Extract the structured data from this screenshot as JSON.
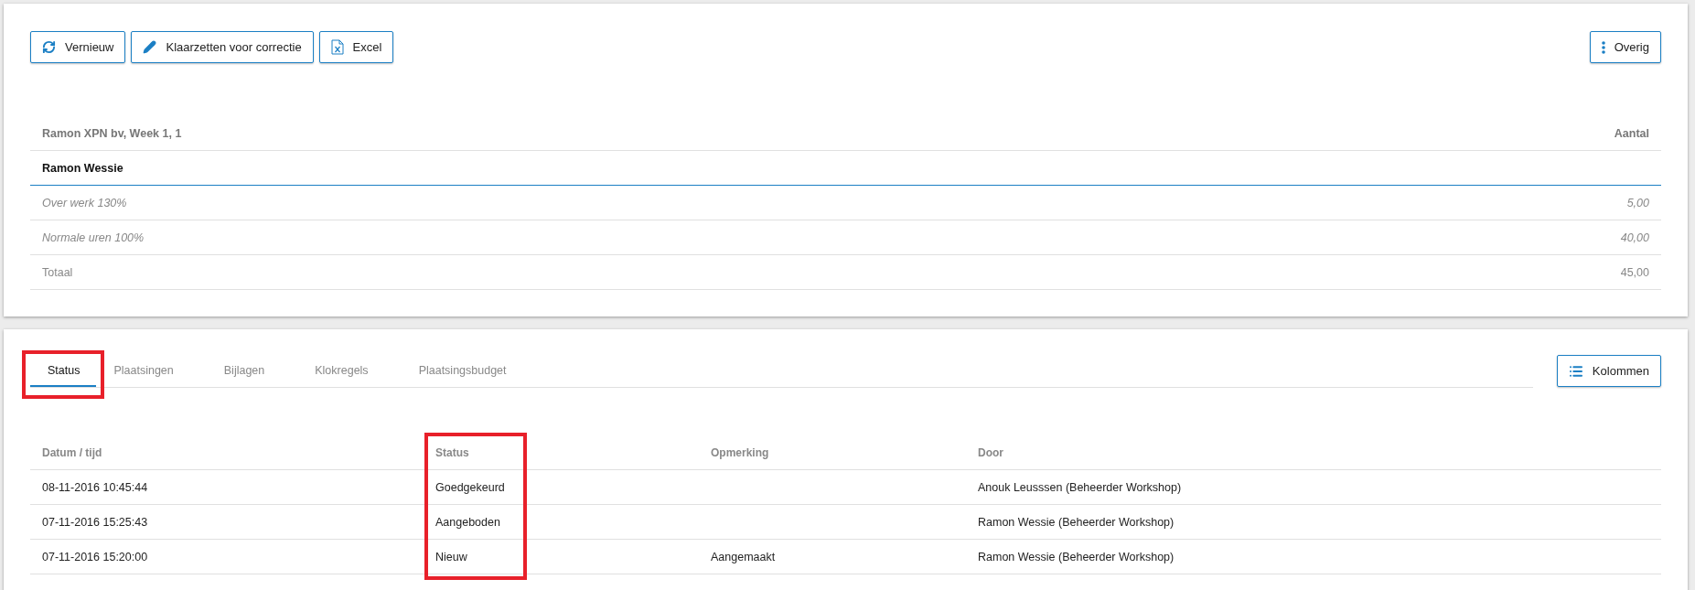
{
  "toolbar": {
    "buttons": [
      {
        "kind": "refresh",
        "label": "Vernieuw"
      },
      {
        "kind": "edit",
        "label": "Klaarzetten voor correctie"
      },
      {
        "kind": "excel",
        "label": "Excel"
      }
    ],
    "menu_button": {
      "label": "Overig"
    }
  },
  "hours_table": {
    "title": "Ramon XPN bv, Week 1, 1",
    "column_2": "Aantal",
    "rows": [
      {
        "kind": "group",
        "label": "Ramon Wessie"
      },
      {
        "kind": "item",
        "label": "Over werk 130%",
        "value": "5,00"
      },
      {
        "kind": "item",
        "label": "Normale uren 100%",
        "value": "40,00"
      },
      {
        "kind": "total",
        "label": "Totaal",
        "value": "45,00"
      }
    ]
  },
  "tabs": [
    {
      "label": "Status",
      "selected": true,
      "highlighted": true
    },
    {
      "label": "Plaatsingen",
      "selected": false,
      "highlighted": false
    },
    {
      "label": "Bijlagen",
      "selected": false,
      "highlighted": false
    },
    {
      "label": "Klokregels",
      "selected": false,
      "highlighted": false
    },
    {
      "label": "Plaatsingsbudget",
      "selected": false,
      "highlighted": false
    }
  ],
  "columns_button": {
    "label": "Kolommen"
  },
  "status_table": {
    "columns": [
      {
        "label": "Datum / tijd",
        "highlighted": false
      },
      {
        "label": "Status",
        "highlighted": true
      },
      {
        "label": "Opmerking",
        "highlighted": false
      },
      {
        "label": "Door",
        "highlighted": false
      }
    ],
    "rows": [
      [
        "08-11-2016 10:45:44",
        "Goedgekeurd",
        "",
        "Anouk Leusssen (Beheerder Workshop)"
      ],
      [
        "07-11-2016 15:25:43",
        "Aangeboden",
        "",
        "Ramon Wessie (Beheerder Workshop)"
      ],
      [
        "07-11-2016 15:20:00",
        "Nieuw",
        "Aangemaakt",
        "Ramon Wessie (Beheerder Workshop)"
      ]
    ]
  }
}
